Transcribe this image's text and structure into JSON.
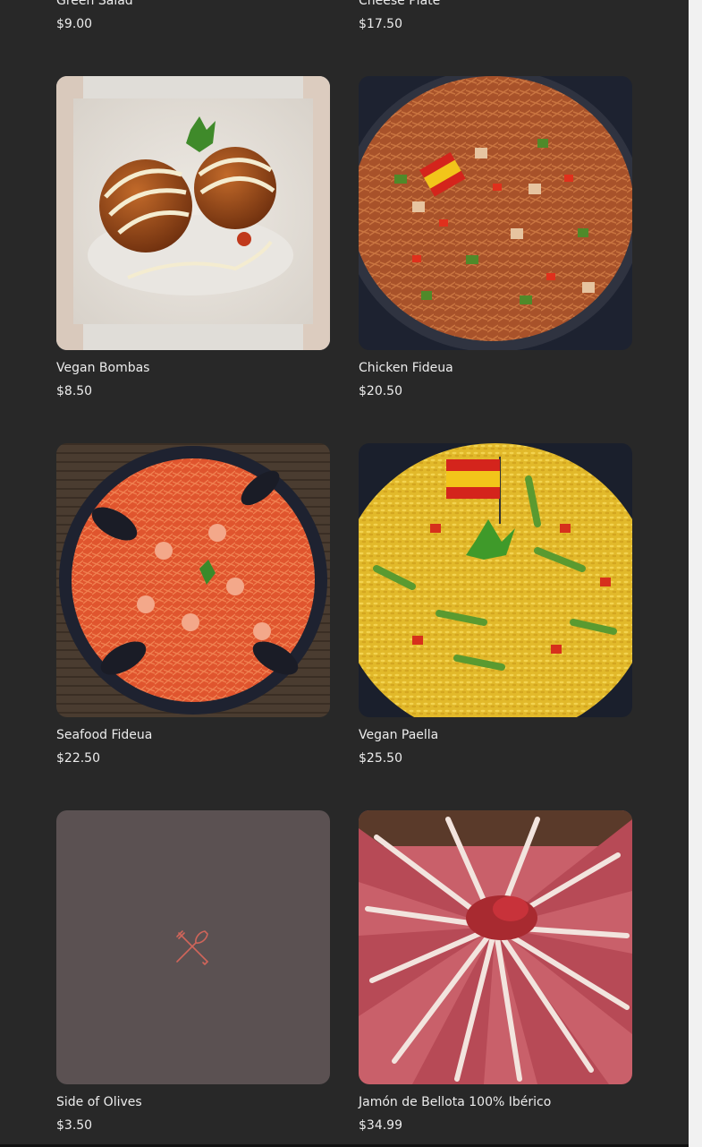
{
  "menu": {
    "items": [
      {
        "name": "Green Salad",
        "price": "$9.00"
      },
      {
        "name": "Cheese Plate",
        "price": "$17.50"
      },
      {
        "name": "Vegan Bombas",
        "price": "$8.50"
      },
      {
        "name": "Chicken Fideua",
        "price": "$20.50"
      },
      {
        "name": "Seafood Fideua",
        "price": "$22.50"
      },
      {
        "name": "Vegan Paella",
        "price": "$25.50"
      },
      {
        "name": "Side of Olives",
        "price": "$3.50"
      },
      {
        "name": "Jamón de Bellota 100% Ibérico",
        "price": "$34.99"
      }
    ]
  },
  "icons": {
    "placeholder": "fork-knife-icon"
  },
  "colors": {
    "background": "#282828",
    "text": "#ececec",
    "placeholder_bg": "#5b5152",
    "placeholder_icon": "#d0655a"
  }
}
